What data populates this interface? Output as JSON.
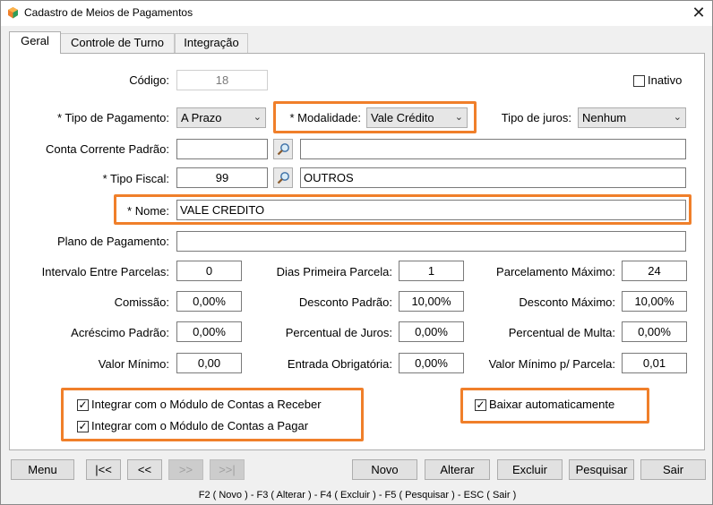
{
  "window": {
    "title": "Cadastro de Meios de Pagamentos",
    "close_glyph": "✕"
  },
  "tabs": [
    {
      "label": "Geral"
    },
    {
      "label": "Controle de Turno"
    },
    {
      "label": "Integração"
    }
  ],
  "form": {
    "codigo": {
      "label": "Código:",
      "value": "18"
    },
    "inativo": {
      "label": "Inativo",
      "checked": false
    },
    "tipo_pagamento": {
      "label": "* Tipo de Pagamento:",
      "value": "A Prazo"
    },
    "modalidade": {
      "label": "* Modalidade:",
      "value": "Vale Crédito"
    },
    "tipo_juros": {
      "label": "Tipo de juros:",
      "value": "Nenhum"
    },
    "conta_corrente": {
      "label": "Conta Corrente Padrão:",
      "code": "",
      "description": ""
    },
    "tipo_fiscal": {
      "label": "* Tipo Fiscal:",
      "code": "99",
      "description": "OUTROS"
    },
    "nome": {
      "label": "* Nome:",
      "value": "VALE CREDITO"
    },
    "plano_pagamento": {
      "label": "Plano de Pagamento:",
      "value": ""
    },
    "intervalo_parcelas": {
      "label": "Intervalo Entre Parcelas:",
      "value": "0"
    },
    "dias_primeira_parcela": {
      "label": "Dias Primeira Parcela:",
      "value": "1"
    },
    "parcelamento_maximo": {
      "label": "Parcelamento Máximo:",
      "value": "24"
    },
    "comissao": {
      "label": "Comissão:",
      "value": "0,00%"
    },
    "desconto_padrao": {
      "label": "Desconto Padrão:",
      "value": "10,00%"
    },
    "desconto_maximo": {
      "label": "Desconto Máximo:",
      "value": "10,00%"
    },
    "acrescimo_padrao": {
      "label": "Acréscimo Padrão:",
      "value": "0,00%"
    },
    "percentual_juros": {
      "label": "Percentual de Juros:",
      "value": "0,00%"
    },
    "percentual_multa": {
      "label": "Percentual de Multa:",
      "value": "0,00%"
    },
    "valor_minimo": {
      "label": "Valor Mínimo:",
      "value": "0,00"
    },
    "entrada_obrigatoria": {
      "label": "Entrada Obrigatória:",
      "value": "0,00%"
    },
    "valor_minimo_parcela": {
      "label": "Valor Mínimo p/ Parcela:",
      "value": "0,01"
    },
    "integrar_receber": {
      "label": "Integrar com o Módulo de Contas a Receber",
      "checked": true
    },
    "integrar_pagar": {
      "label": "Integrar com o Módulo de Contas a Pagar",
      "checked": true
    },
    "baixar_auto": {
      "label": "Baixar automaticamente",
      "checked": true
    }
  },
  "toolbar": {
    "menu": "Menu",
    "first": "|<<",
    "prev": "<<",
    "next": ">>",
    "last": ">>|",
    "novo": "Novo",
    "alterar": "Alterar",
    "excluir": "Excluir",
    "pesquisar": "Pesquisar",
    "sair": "Sair"
  },
  "shortcuts": "F2 ( Novo )  -  F3 ( Alterar )  -  F4 ( Excluir )  -  F5 ( Pesquisar )  -  ESC ( Sair )",
  "colors": {
    "highlight": "#f07f2a"
  }
}
